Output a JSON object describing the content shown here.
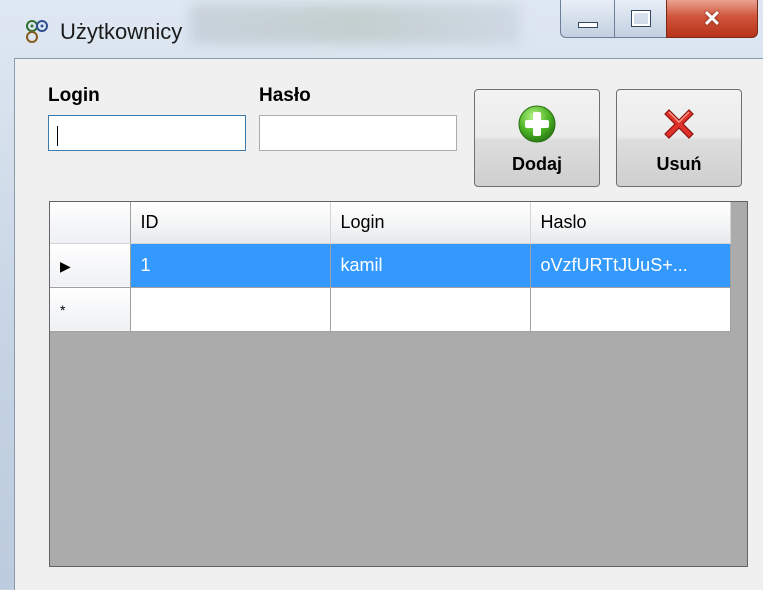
{
  "window": {
    "title": "Użytkownicy",
    "close_glyph": "✕"
  },
  "form": {
    "login_label": "Login",
    "login_value": "",
    "haslo_label": "Hasło",
    "haslo_value": ""
  },
  "buttons": {
    "add": {
      "label": "Dodaj",
      "icon": "green-plus-icon"
    },
    "remove": {
      "label": "Usuń",
      "icon": "red-x-icon"
    }
  },
  "grid": {
    "columns": [
      "ID",
      "Login",
      "Haslo"
    ],
    "rows": [
      {
        "marker": "▶",
        "id": "1",
        "login": "kamil",
        "haslo": "oVzfURTtJUuS+..."
      }
    ],
    "new_row_marker": "*"
  },
  "colors": {
    "selection": "#3399ff",
    "grid_background": "#ababab",
    "close_button": "#c8452c"
  }
}
